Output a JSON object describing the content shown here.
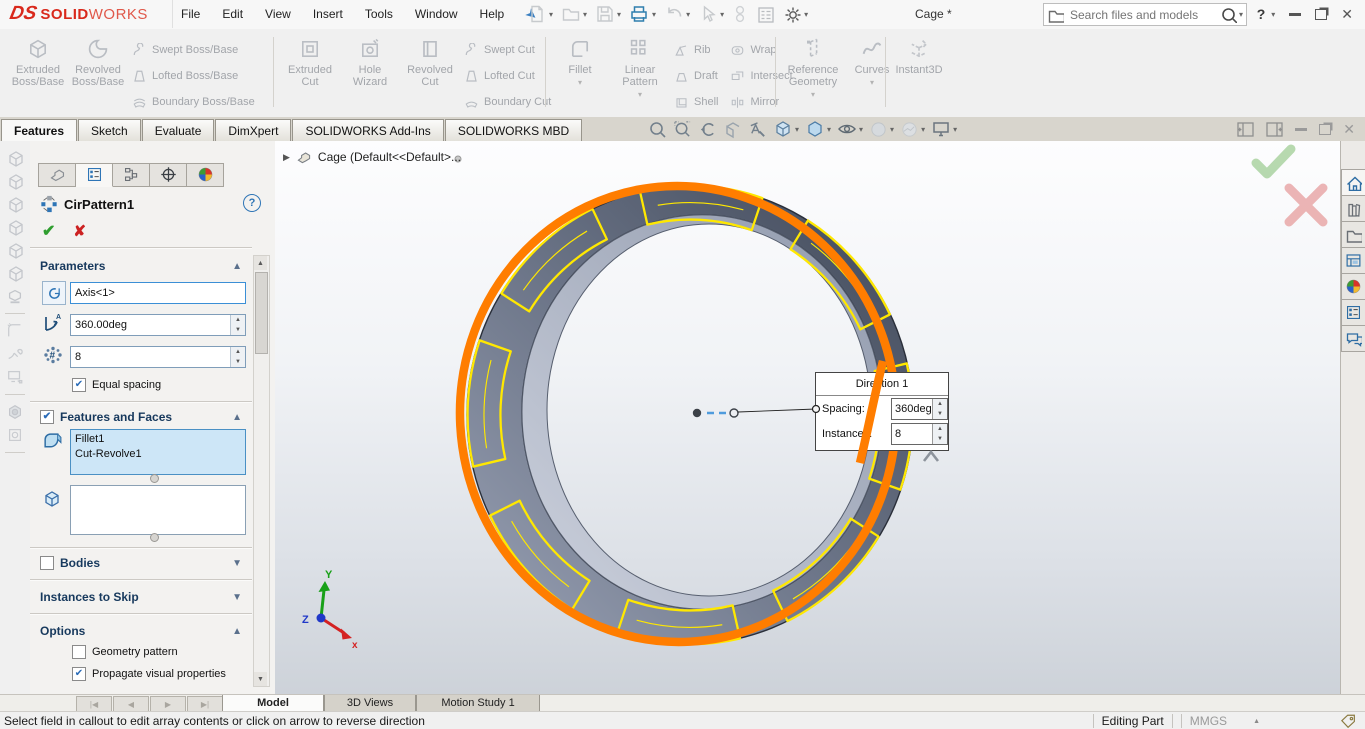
{
  "titlebar": {
    "brand": {
      "mark": "DS",
      "bold": "SOLID",
      "light": "WORKS"
    },
    "menus": [
      "File",
      "Edit",
      "View",
      "Insert",
      "Tools",
      "Window",
      "Help"
    ],
    "document_title": "Cage *",
    "search_placeholder": "Search files and models",
    "help_label": "?"
  },
  "ribbon": {
    "boss": {
      "large": [
        {
          "l1": "Extruded",
          "l2": "Boss/Base"
        },
        {
          "l1": "Revolved",
          "l2": "Boss/Base"
        }
      ],
      "small": [
        "Swept Boss/Base",
        "Lofted Boss/Base",
        "Boundary Boss/Base"
      ]
    },
    "cut": {
      "large": [
        {
          "l1": "Extruded",
          "l2": "Cut"
        },
        {
          "l1": "Hole",
          "l2": "Wizard"
        },
        {
          "l1": "Revolved",
          "l2": "Cut"
        }
      ],
      "small": [
        "Swept Cut",
        "Lofted Cut",
        "Boundary Cut"
      ]
    },
    "pattern": {
      "large": [
        {
          "l1": "Fillet",
          "l2": ""
        },
        {
          "l1": "Linear",
          "l2": "Pattern"
        }
      ],
      "small_a": [
        "Rib",
        "Draft",
        "Shell"
      ],
      "small_b": [
        "Wrap",
        "Intersect",
        "Mirror"
      ]
    },
    "reference": {
      "large": [
        {
          "l1": "Reference",
          "l2": "Geometry"
        },
        {
          "l1": "Curves",
          "l2": ""
        }
      ]
    },
    "instant3d": {
      "label": "Instant3D"
    }
  },
  "tabs": {
    "items": [
      "Features",
      "Sketch",
      "Evaluate",
      "DimXpert",
      "SOLIDWORKS Add-Ins",
      "SOLIDWORKS MBD"
    ]
  },
  "pm": {
    "title": "CirPattern1",
    "parameters": {
      "header": "Parameters",
      "axis_value": "Axis<1>",
      "angle_value": "360.00deg",
      "count_value": "8",
      "equal_spacing_label": "Equal spacing"
    },
    "features_faces": {
      "header": "Features and Faces",
      "selected_items": [
        "Fillet1",
        "Cut-Revolve1"
      ]
    },
    "bodies": {
      "header": "Bodies"
    },
    "instances_to_skip": {
      "header": "Instances to Skip"
    },
    "options": {
      "header": "Options",
      "geometry_pattern_label": "Geometry pattern",
      "propagate_label": "Propagate visual properties"
    }
  },
  "viewport": {
    "breadcrumb": "Cage  (Default<<Default>...",
    "callout": {
      "title": "Direction 1",
      "spacing_label": "Spacing:",
      "spacing_value": "360deg",
      "instances_label": "Instances:",
      "instances_value": "8"
    },
    "triad": {
      "x": "x",
      "y": "Y",
      "z": "Z"
    }
  },
  "colors": {
    "selection_orange": "#ff7d00",
    "highlight_yellow": "#ffe800",
    "brand_red": "#d9291c",
    "accent_blue": "#2e75b6"
  },
  "bottom": {
    "tabs": [
      "Model",
      "3D Views",
      "Motion Study 1"
    ]
  },
  "status": {
    "message": "Select field in callout to edit array contents or click on arrow to reverse direction",
    "editing": "Editing Part",
    "units": "MMGS"
  }
}
